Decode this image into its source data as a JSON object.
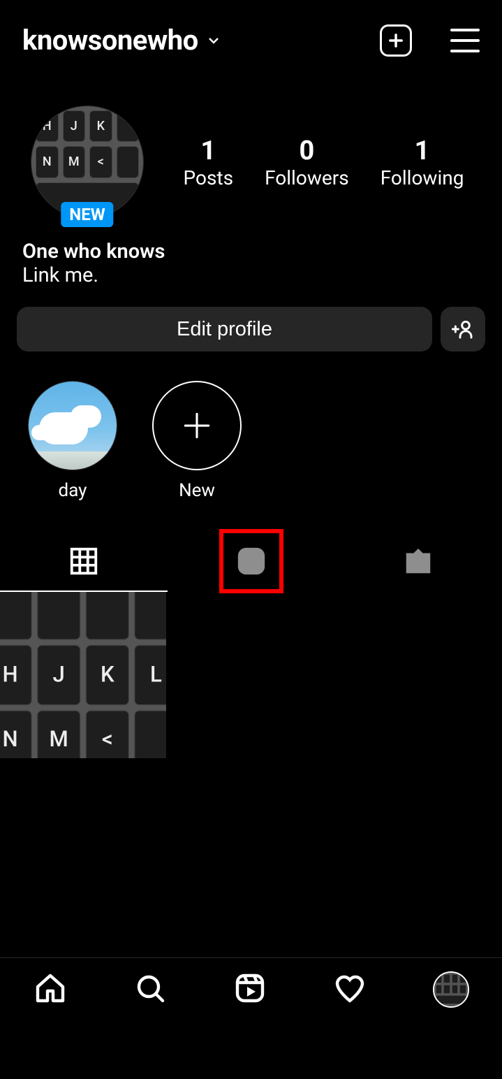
{
  "header": {
    "username": "knowsonewho"
  },
  "profile": {
    "avatar_badge": "NEW",
    "display_name": "One who knows",
    "bio": "Link me."
  },
  "stats": {
    "posts_count": "1",
    "posts_label": "Posts",
    "followers_count": "0",
    "followers_label": "Followers",
    "following_count": "1",
    "following_label": "Following"
  },
  "buttons": {
    "edit_profile": "Edit profile"
  },
  "highlights": [
    {
      "label": "day"
    },
    {
      "label": "New"
    }
  ],
  "tabs": {
    "active": "grid",
    "highlighted": "reels"
  }
}
